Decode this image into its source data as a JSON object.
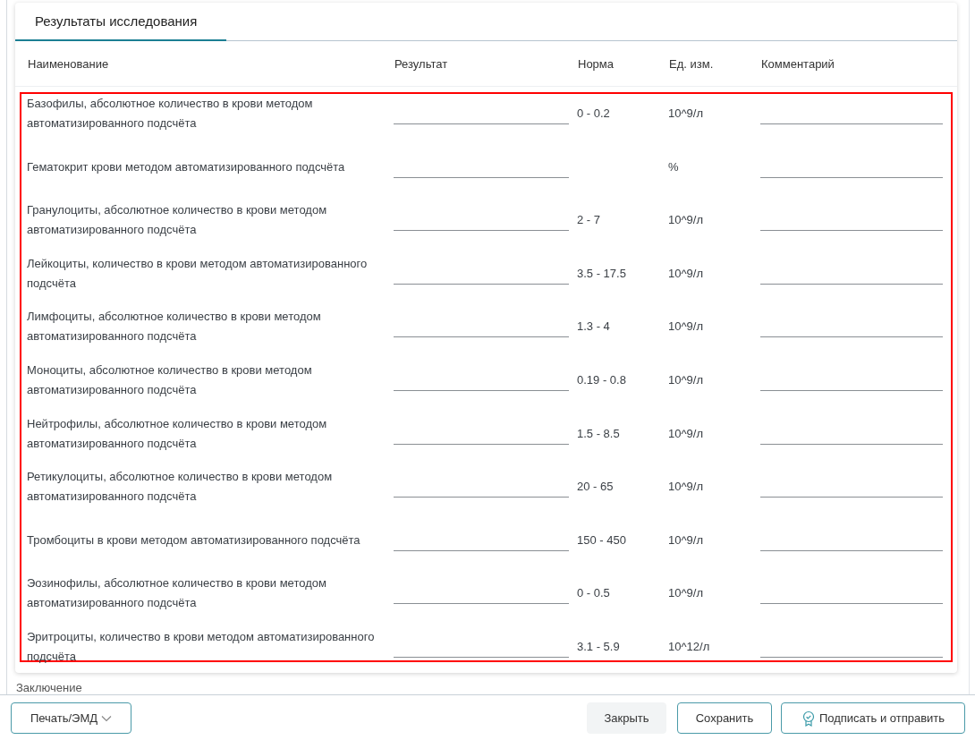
{
  "tabs": [
    {
      "label": "Результаты исследования",
      "selected": true
    }
  ],
  "table": {
    "columns": [
      "Наименование",
      "Результат",
      "Норма",
      "Ед. изм.",
      "Комментарий"
    ],
    "rows": [
      {
        "name": "Базофилы, абсолютное количество в крови методом автоматизированного подсчёта",
        "norm": "0 - 0.2",
        "unit": "10^9/л"
      },
      {
        "name": "Гематокрит крови методом автоматизированного подсчёта",
        "unit": "%"
      },
      {
        "name": "Гранулоциты, абсолютное количество в крови методом автоматизированного подсчёта",
        "norm": "2 - 7",
        "unit": "10^9/л"
      },
      {
        "name": "Лейкоциты, количество в крови методом автоматизированного подсчёта",
        "norm": "3.5 - 17.5",
        "unit": "10^9/л"
      },
      {
        "name": "Лимфоциты, абсолютное количество в крови методом автоматизированного подсчёта",
        "norm": "1.3 - 4",
        "unit": "10^9/л"
      },
      {
        "name": "Моноциты, абсолютное количество в крови методом автоматизированного подсчёта",
        "norm": "0.19 - 0.8",
        "unit": "10^9/л"
      },
      {
        "name": "Нейтрофилы, абсолютное количество в крови методом автоматизированного подсчёта",
        "norm": "1.5 - 8.5",
        "unit": "10^9/л"
      },
      {
        "name": "Ретикулоциты, абсолютное количество в крови методом автоматизированного подсчёта",
        "norm": "20 - 65",
        "unit": "10^9/л"
      },
      {
        "name": "Тромбоциты в крови методом автоматизированного подсчёта",
        "norm": "150 - 450",
        "unit": "10^9/л"
      },
      {
        "name": "Эозинофилы, абсолютное количество в крови методом автоматизированного подсчёта",
        "norm": "0 - 0.5",
        "unit": "10^9/л"
      },
      {
        "name": "Эритроциты, количество в крови методом автоматизированного подсчёта",
        "norm": "3.1 - 5.9",
        "unit": "10^12/л"
      }
    ]
  },
  "section_label": "Заключение",
  "footer": {
    "left_button": "Печать/ЭМД",
    "buttons": [
      {
        "label": "Закрыть",
        "kind": "plain"
      },
      {
        "label": "Сохранить",
        "kind": "outline"
      },
      {
        "label": "Подписать и отправить",
        "kind": "sign"
      }
    ]
  }
}
